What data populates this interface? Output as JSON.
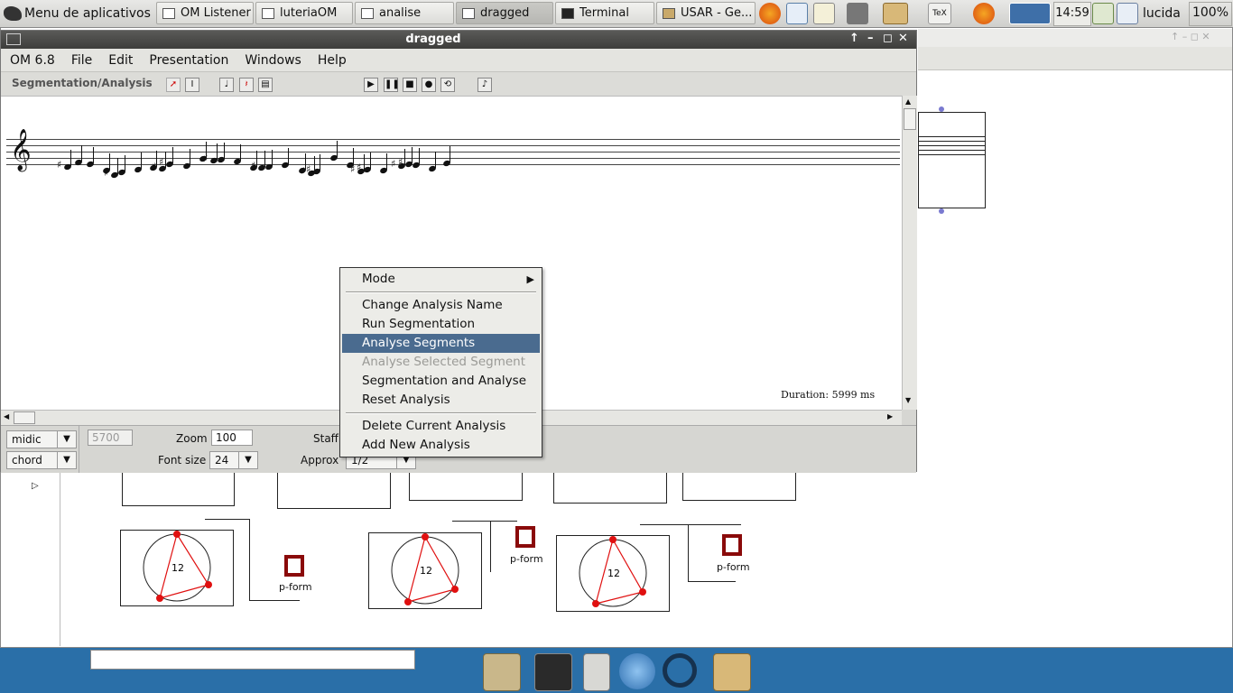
{
  "taskbar": {
    "app_menu": "Menu de aplicativos",
    "tasks": [
      {
        "label": "OM Listener"
      },
      {
        "label": "luteriaOM"
      },
      {
        "label": "analise"
      },
      {
        "label": "dragged"
      },
      {
        "label": "Terminal"
      },
      {
        "label": "USAR - Ge..."
      }
    ],
    "clock": "14:59",
    "user": "lucida",
    "battery": "100%",
    "tex_label": "TeX"
  },
  "window": {
    "title": "dragged",
    "menu": [
      "OM 6.8",
      "File",
      "Edit",
      "Presentation",
      "Windows",
      "Help"
    ],
    "mode_label": "Segmentation/Analysis",
    "duration": "Duration: 5999 ms"
  },
  "bottom_panel": {
    "editor_value": "midic",
    "view_value": "chord",
    "offset_field": "5700",
    "zoom_label": "Zoom",
    "zoom_value": "100",
    "staff_label": "Staff",
    "font_size_label": "Font size",
    "font_size_value": "24",
    "approx_label": "Approx",
    "approx_value": "1/2"
  },
  "context_menu": {
    "items": [
      {
        "label": "Mode",
        "submenu": true
      },
      {
        "label": "Change Analysis Name"
      },
      {
        "label": "Run Segmentation"
      },
      {
        "label": "Analyse Segments",
        "highlighted": true
      },
      {
        "label": "Analyse Selected Segment",
        "disabled": true
      },
      {
        "label": "Segmentation and Analyse"
      },
      {
        "label": "Reset Analysis"
      },
      {
        "label": "Delete Current Analysis"
      },
      {
        "label": "Add New Analysis"
      }
    ]
  },
  "patch": {
    "clock_label": "12",
    "pform_label": "p-form"
  },
  "colors": {
    "highlight": "#4a6b8f",
    "desktop": "#2a6fa8",
    "pform_red": "#8a0a0a"
  }
}
